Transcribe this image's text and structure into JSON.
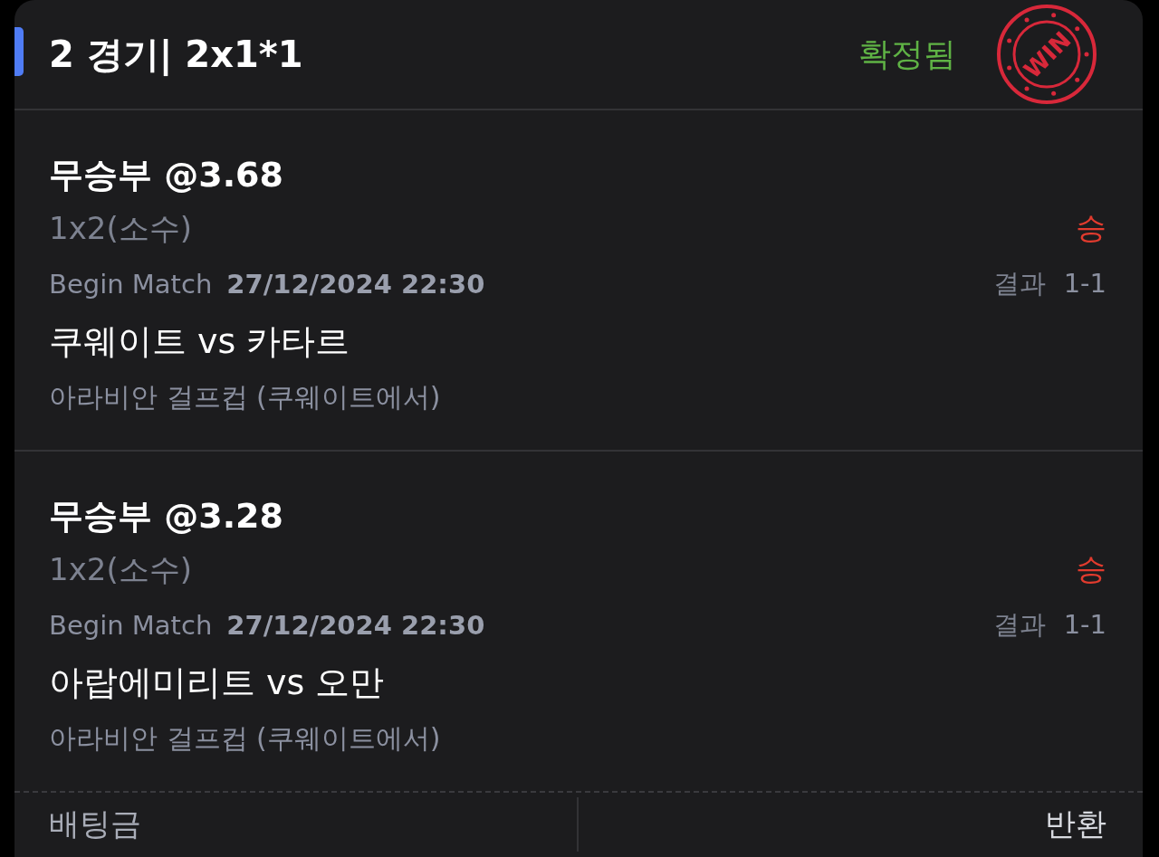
{
  "header": {
    "title": "2 경기| 2x1*1",
    "status": "확정됨",
    "stamp_text": "WIN"
  },
  "selections": [
    {
      "pick": "무승부 @3.68",
      "market": "1x2(소수)",
      "outcome": "승",
      "begin_label": "Begin Match",
      "datetime": "27/12/2024 22:30",
      "result_label": "결과",
      "result_score": "1-1",
      "teams": "쿠웨이트 vs 카타르",
      "league": "아라비안 걸프컵 (쿠웨이트에서)"
    },
    {
      "pick": "무승부 @3.28",
      "market": "1x2(소수)",
      "outcome": "승",
      "begin_label": "Begin Match",
      "datetime": "27/12/2024 22:30",
      "result_label": "결과",
      "result_score": "1-1",
      "teams": "아랍에미리트 vs 오만",
      "league": "아라비안 걸프컵 (쿠웨이트에서)"
    }
  ],
  "footer": {
    "stake_label": "배팅금",
    "return_label": "반환"
  }
}
